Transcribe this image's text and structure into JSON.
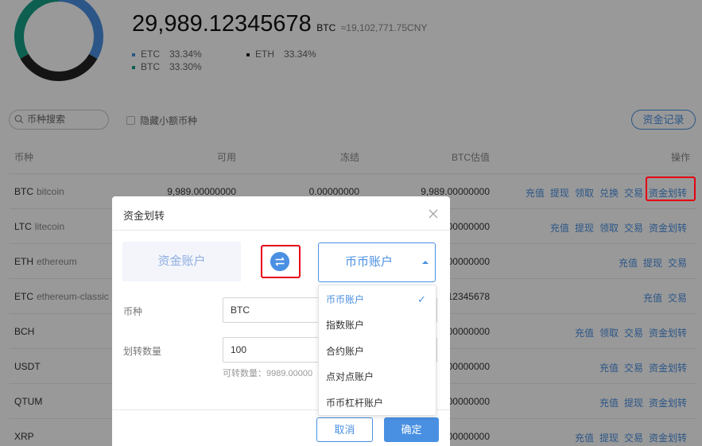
{
  "summary": {
    "total_amount": "29,989.12345678",
    "unit": "BTC",
    "cny_value": "≈19,102,771.75CNY",
    "donut": [
      {
        "name": "ETC",
        "percent": 33.34,
        "color": "#4a90e2"
      },
      {
        "name": "ETH",
        "percent": 33.34,
        "color": "#222222"
      },
      {
        "name": "BTC",
        "percent": 33.3,
        "color": "#16a085"
      }
    ],
    "legend": [
      {
        "name": "ETC",
        "value": "33.34%",
        "color": "#4a90e2"
      },
      {
        "name": "ETH",
        "value": "33.34%",
        "color": "#222222"
      },
      {
        "name": "BTC",
        "value": "33.30%",
        "color": "#16a085"
      }
    ]
  },
  "toolbar": {
    "search_placeholder": "币种搜索",
    "hide_small_label": "隐藏小额币种",
    "record_label": "资金记录"
  },
  "table": {
    "headers": {
      "coin": "币种",
      "available": "可用",
      "frozen": "冻结",
      "btc_value": "BTC估值",
      "actions": "操作"
    },
    "rows": [
      {
        "symbol": "BTC",
        "name": "bitcoin",
        "available": "9,989.00000000",
        "frozen": "0.00000000",
        "btc_value": "9,989.00000000",
        "ops": [
          "充值",
          "提现",
          "领取",
          "兑换",
          "交易",
          "资金划转"
        ]
      },
      {
        "symbol": "LTC",
        "name": "litecoin",
        "available": "",
        "frozen": "",
        "btc_value": "00000000",
        "ops": [
          "充值",
          "提现",
          "领取",
          "交易",
          "资金划转"
        ]
      },
      {
        "symbol": "ETH",
        "name": "ethereum",
        "available": "",
        "frozen": "",
        "btc_value": "00000000",
        "ops": [
          "充值",
          "提现",
          "交易"
        ]
      },
      {
        "symbol": "ETC",
        "name": "ethereum-classic",
        "available": "",
        "frozen": "",
        "btc_value": "12345678",
        "ops": [
          "充值",
          "交易"
        ]
      },
      {
        "symbol": "BCH",
        "name": "",
        "available": "",
        "frozen": "",
        "btc_value": "00000000",
        "ops": [
          "充值",
          "领取",
          "交易",
          "资金划转"
        ]
      },
      {
        "symbol": "USDT",
        "name": "",
        "available": "",
        "frozen": "",
        "btc_value": "00000000",
        "ops": [
          "充值",
          "交易",
          "资金划转"
        ]
      },
      {
        "symbol": "QTUM",
        "name": "",
        "available": "",
        "frozen": "",
        "btc_value": "00000000",
        "ops": [
          "充值",
          "提现",
          "资金划转"
        ]
      },
      {
        "symbol": "XRP",
        "name": "",
        "available": "",
        "frozen": "",
        "btc_value": "00000000",
        "ops": [
          "充值",
          "提现",
          "交易",
          "资金划转"
        ]
      }
    ]
  },
  "modal": {
    "title": "资金划转",
    "from_account": "资金账户",
    "to_account": "币币账户",
    "coin_label": "币种",
    "coin_value": "BTC",
    "amount_label": "划转数量",
    "amount_value": "100",
    "hint": "可转数量：9989.00000",
    "cancel_label": "取消",
    "confirm_label": "确定"
  },
  "dropdown": {
    "selected": "币币账户",
    "options": [
      "币币账户",
      "指数账户",
      "合约账户",
      "点对点账户",
      "币币杠杆账户"
    ]
  },
  "colors": {
    "accent": "#4a90e2",
    "highlight": "#e60012"
  }
}
